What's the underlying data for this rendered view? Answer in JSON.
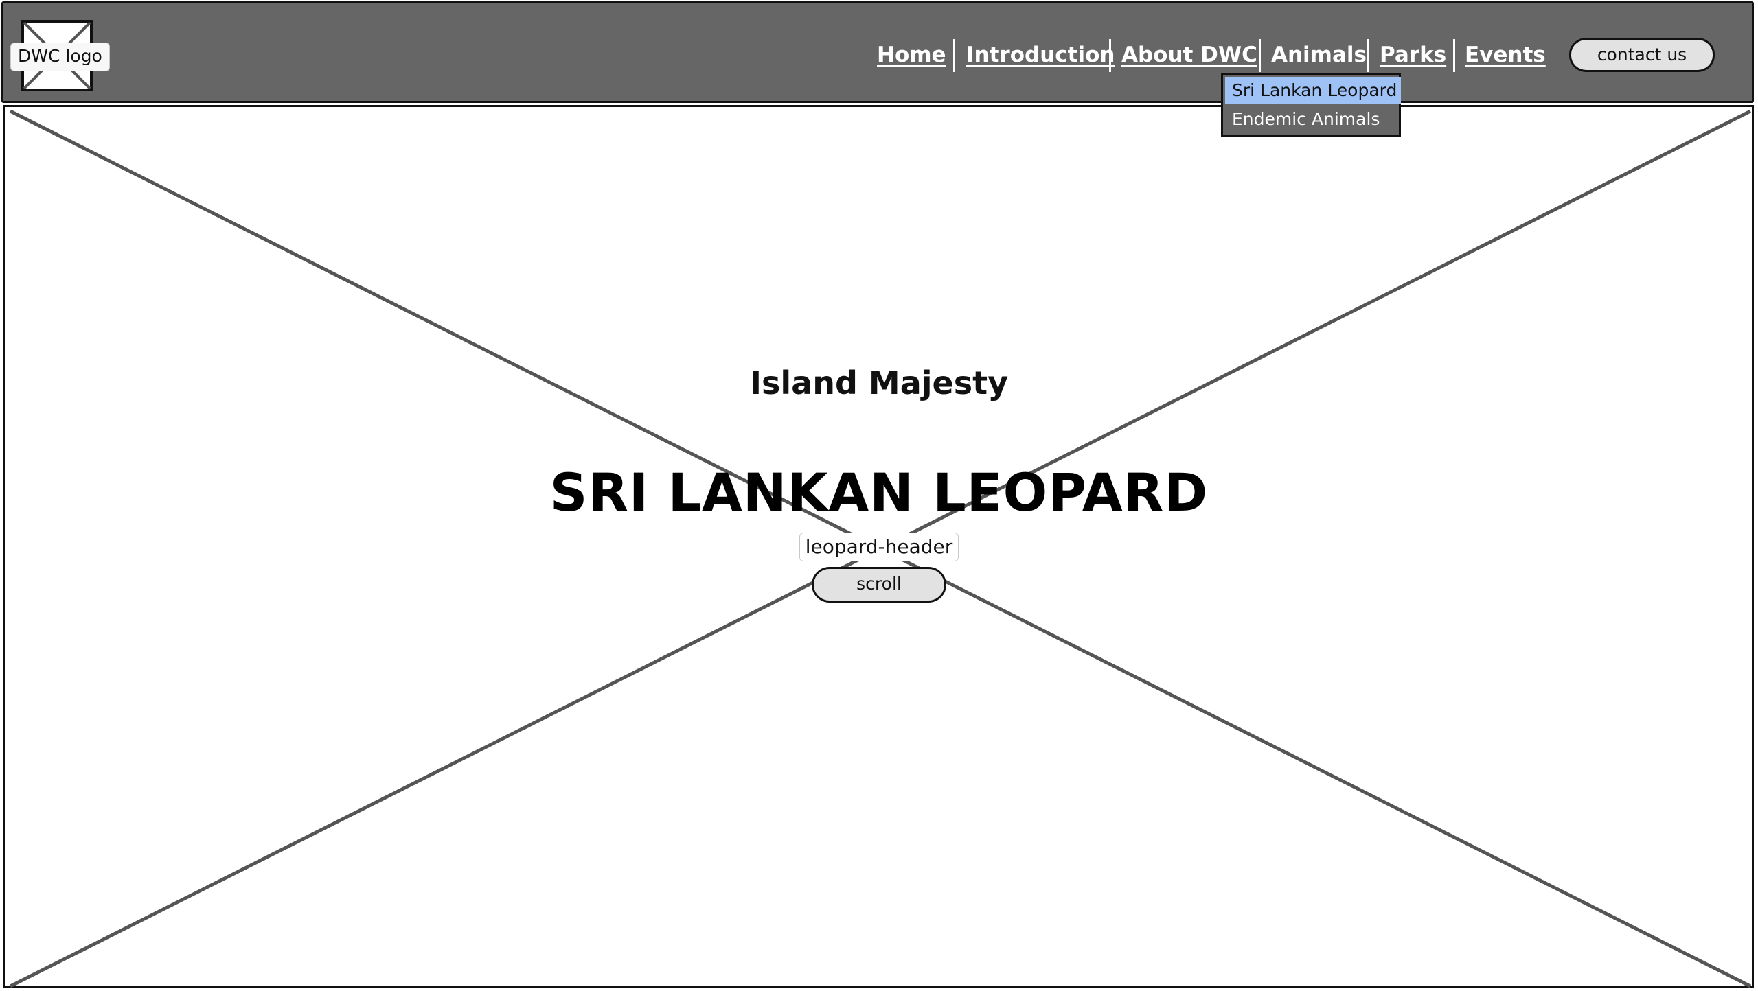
{
  "header": {
    "logo": {
      "label": "DWC logo"
    },
    "nav": {
      "items": [
        {
          "label": "Home"
        },
        {
          "label": "Introduction"
        },
        {
          "label": "About DWC"
        },
        {
          "label": "Animals"
        },
        {
          "label": "Parks"
        },
        {
          "label": "Events"
        }
      ]
    },
    "contact_button": "contact us"
  },
  "animals_dropdown": {
    "items": [
      {
        "label": "Sri Lankan Leopard",
        "selected": true
      },
      {
        "label": "Endemic Animals",
        "selected": false
      }
    ],
    "selected_color": "#9ec2f5"
  },
  "hero": {
    "image_label": "leopard-header",
    "subtitle": "Island Majesty",
    "title": "SRI LANKAN LEOPARD",
    "scroll_button": "scroll"
  },
  "colors": {
    "header_background": "#666666",
    "outline": "#111111",
    "button_fill": "#e2e2e2",
    "placeholder_cross": "#555555"
  },
  "icons": {
    "logo_placeholder": "image-placeholder-icon",
    "hero_placeholder": "image-placeholder-icon"
  }
}
